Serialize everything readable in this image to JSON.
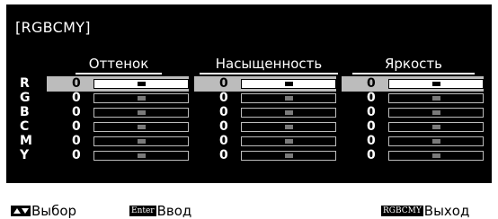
{
  "title": "[RGBCMY]",
  "columns": [
    "Оттенок",
    "Насыщенность",
    "Яркость"
  ],
  "rows": [
    {
      "label": "R",
      "values": [
        "0",
        "0",
        "0"
      ],
      "levels": [
        0.5,
        0.5,
        0.5
      ]
    },
    {
      "label": "G",
      "values": [
        "0",
        "0",
        "0"
      ],
      "levels": [
        0.5,
        0.5,
        0.5
      ]
    },
    {
      "label": "B",
      "values": [
        "0",
        "0",
        "0"
      ],
      "levels": [
        0.5,
        0.5,
        0.5
      ]
    },
    {
      "label": "C",
      "values": [
        "0",
        "0",
        "0"
      ],
      "levels": [
        0.5,
        0.5,
        0.5
      ]
    },
    {
      "label": "M",
      "values": [
        "0",
        "0",
        "0"
      ],
      "levels": [
        0.5,
        0.5,
        0.5
      ]
    },
    {
      "label": "Y",
      "values": [
        "0",
        "0",
        "0"
      ],
      "levels": [
        0.5,
        0.5,
        0.5
      ]
    }
  ],
  "selected_row": 0,
  "footer": {
    "select_label": "Выбор",
    "enter_key": "Enter",
    "enter_label": "Ввод",
    "exit_key": "RGBCMY",
    "exit_label": "Выход"
  },
  "colors": {
    "panel": "#000000",
    "selected": "#bcbcbc",
    "knob": "#7a7a7a"
  }
}
